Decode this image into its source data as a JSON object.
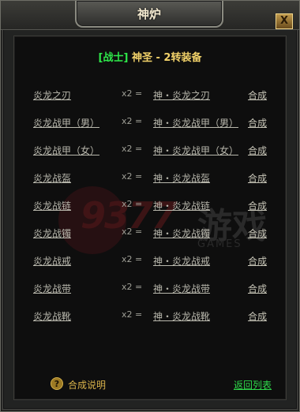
{
  "window": {
    "title": "神炉",
    "close_label": "X"
  },
  "header": {
    "class_label": "[战士]",
    "title": "神圣 - 2转装备"
  },
  "recipes": [
    {
      "source": "炎龙之刃",
      "multiplier": "x2 =",
      "result": "神・炎龙之刃",
      "action": "合成"
    },
    {
      "source": "炎龙战甲（男）",
      "multiplier": "x2 =",
      "result": "神・炎龙战甲（男）",
      "action": "合成"
    },
    {
      "source": "炎龙战甲（女）",
      "multiplier": "x2 =",
      "result": "神・炎龙战甲（女）",
      "action": "合成"
    },
    {
      "source": "炎龙战盔",
      "multiplier": "x2 =",
      "result": "神・炎龙战盔",
      "action": "合成"
    },
    {
      "source": "炎龙战链",
      "multiplier": "x2 =",
      "result": "神・炎龙战链",
      "action": "合成"
    },
    {
      "source": "炎龙战镯",
      "multiplier": "x2 =",
      "result": "神・炎龙战镯",
      "action": "合成"
    },
    {
      "source": "炎龙战戒",
      "multiplier": "x2 =",
      "result": "神・炎龙战戒",
      "action": "合成"
    },
    {
      "source": "炎龙战带",
      "multiplier": "x2 =",
      "result": "神・炎龙战带",
      "action": "合成"
    },
    {
      "source": "炎龙战靴",
      "multiplier": "x2 =",
      "result": "神・炎龙战靴",
      "action": "合成"
    }
  ],
  "footer": {
    "help_icon": "?",
    "help_label": "合成说明",
    "back_label": "返回列表"
  },
  "watermark": {
    "number": "9377",
    "chinese": "游戏",
    "sub": "GAMES"
  },
  "colors": {
    "class_green": "#2ee84a",
    "title_gold": "#f3d36a",
    "link_gray": "#b9b8ad",
    "help_gold": "#d8b24a",
    "back_green": "#2ed84a"
  }
}
